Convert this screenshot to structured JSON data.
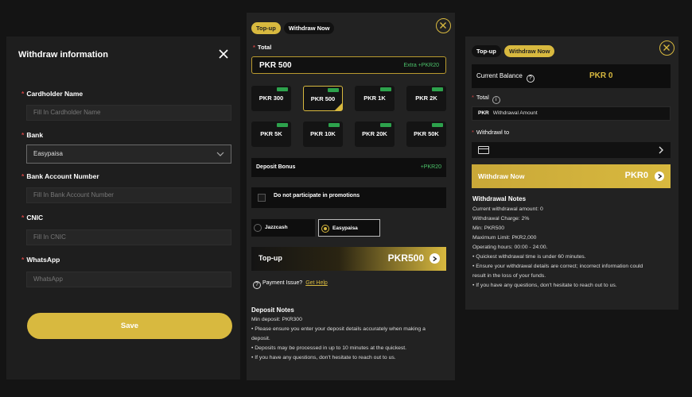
{
  "colors": {
    "accent": "#d8b93f",
    "green": "#4cc36a",
    "required": "#cc4444"
  },
  "withdraw_form": {
    "title": "Withdraw information",
    "fields": [
      {
        "label": "Cardholder Name",
        "placeholder": "Fill In Cardholder Name"
      },
      {
        "label": "Bank",
        "value": "Easypaisa"
      },
      {
        "label": "Bank Account Number",
        "placeholder": "Fill In Bank Account Number"
      },
      {
        "label": "CNIC",
        "placeholder": "Fill In CNIC"
      },
      {
        "label": "WhatsApp",
        "placeholder": "WhatsApp"
      }
    ],
    "save_label": "Save"
  },
  "topup": {
    "tabs": [
      "Top-up",
      "Withdraw Now"
    ],
    "total_label": "Total",
    "amount": "PKR  500",
    "extra": "Extra +PKR20",
    "chips": [
      "PKR 300",
      "PKR 500",
      "PKR 1K",
      "PKR 2K",
      "PKR 5K",
      "PKR 10K",
      "PKR 20K",
      "PKR 50K"
    ],
    "bonus_label": "Deposit Bonus",
    "bonus_value": "+PKR20",
    "promo_label": "Do not participate in promotions",
    "methods": [
      "Jazzcash",
      "Easypaisa"
    ],
    "button_label": "Top-up",
    "button_amount": "PKR500",
    "help_text": "Payment Issue?",
    "help_link": "Get Help",
    "notes_title": "Deposit Notes",
    "notes": [
      "Min deposit: PKR300",
      "• Please ensure you enter your deposit details accurately when making a",
      "deposit.",
      "• Deposits may be processed in up to 10 minutes at the quickest.",
      "• If you have any questions, don't hesitate to reach out to us."
    ]
  },
  "withdraw": {
    "tabs": [
      "Top-up",
      "Withdraw Now"
    ],
    "balance_label": "Current Balance",
    "balance_value": "PKR 0",
    "total_label": "Total",
    "currency": "PKR",
    "amount_placeholder": "Withdrawal Amount",
    "withdraw_to_label": "Withdrawl to",
    "button_label": "Withdraw Now",
    "button_amount": "PKR0",
    "notes_title": "Withdrawal Notes",
    "notes": [
      "Current withdrawal amount: 0",
      "Withdrawal Charge: 2%",
      "Min: PKR500",
      "Maximum Limit: PKR2,000",
      "Operating hours: 00:00 - 24:00.",
      "• Quickest withdrawal time is under 60 minutes.",
      "• Ensure your withdrawal details are correct; incorrect information could",
      "result in the loss of your funds.",
      "• If you have any questions, don't hesitate to reach out to us."
    ]
  }
}
